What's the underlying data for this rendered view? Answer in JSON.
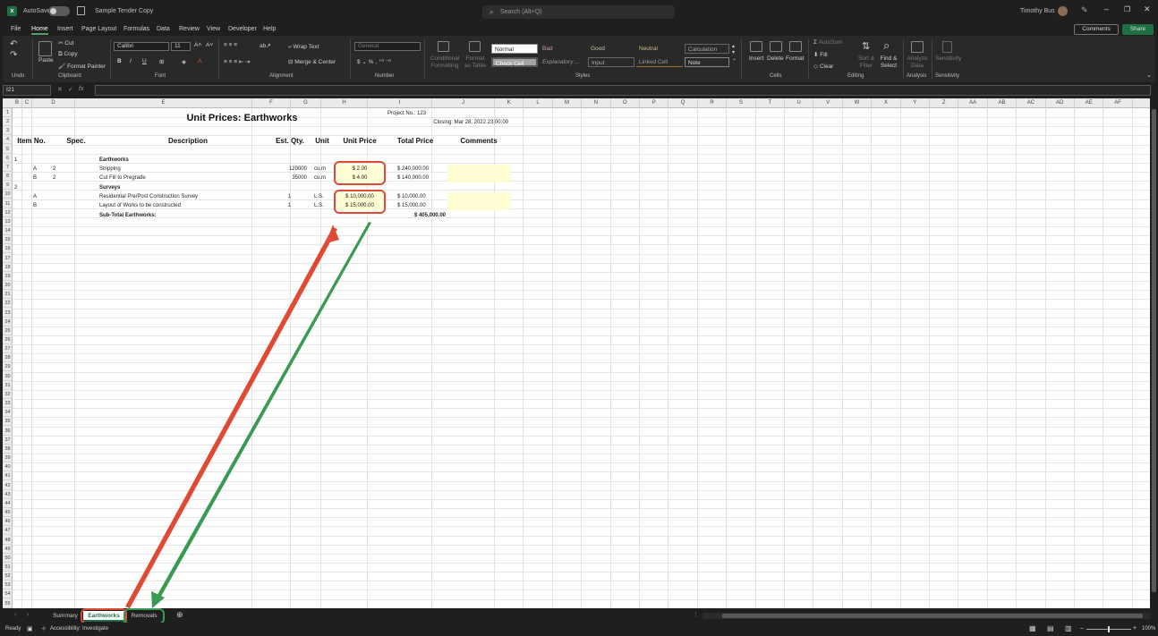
{
  "titlebar": {
    "autosave": "AutoSave",
    "file_name": "Sample Tender Copy",
    "search": "Search (Alt+Q)",
    "user": "Timothy Bus"
  },
  "menu": [
    "File",
    "Home",
    "Insert",
    "Page Layout",
    "Formulas",
    "Data",
    "Review",
    "View",
    "Developer",
    "Help"
  ],
  "top_buttons": {
    "comments": "Comments",
    "share": "Share"
  },
  "ribbon": {
    "undo": "Undo",
    "clipboard": {
      "cut": "Cut",
      "copy": "Copy",
      "paste": "Paste",
      "painter": "Format Painter",
      "label": "Clipboard"
    },
    "font": {
      "name": "Calibri",
      "size": "11",
      "label": "Font"
    },
    "alignment": {
      "wrap": "Wrap Text",
      "merge": "Merge & Center",
      "label": "Alignment"
    },
    "number": {
      "format": "General",
      "label": "Number"
    },
    "styles": {
      "cond": "Conditional Formatting",
      "table": "Format as Table",
      "cells": [
        "Normal",
        "Bad",
        "Good",
        "Neutral",
        "Calculation",
        "Check Cell",
        "Explanatory ...",
        "Input",
        "Linked Cell",
        "Note"
      ],
      "label": "Styles"
    },
    "cells": {
      "insert": "Insert",
      "delete": "Delete",
      "format": "Format",
      "label": "Cells"
    },
    "editing": {
      "autosum": "AutoSum",
      "fill": "Fill",
      "clear": "Clear",
      "sort": "Sort & Filter",
      "find": "Find & Select",
      "label": "Editing"
    },
    "analysis": {
      "analyze": "Analyze Data",
      "label": "Analysis"
    },
    "sensitivity": {
      "btn": "Sensitivity",
      "label": "Sensitivity"
    }
  },
  "formula_bar": {
    "name_box": "I21"
  },
  "columns": [
    "B",
    "C",
    "D",
    "E",
    "F",
    "G",
    "H",
    "I",
    "J",
    "K",
    "L",
    "M",
    "N",
    "O",
    "P",
    "Q",
    "R",
    "S",
    "T",
    "U",
    "V",
    "W",
    "X",
    "Y",
    "Z",
    "AA",
    "AB",
    "AC",
    "AD",
    "AE",
    "AF"
  ],
  "sheet": {
    "title": "Unit Prices: Earthworks",
    "project_no": "Project No.: 123",
    "closing": "Closing: Mar 28, 2022 23:00:00",
    "headers": {
      "item": "Item No.",
      "spec": "Spec.",
      "desc": "Description",
      "qty": "Est. Qty.",
      "unit": "Unit",
      "price": "Unit Price",
      "total": "Total Price",
      "comments": "Comments"
    },
    "rows": [
      {
        "row": 6,
        "b": "1",
        "c": "",
        "d": "",
        "e": "",
        "f": "",
        "g": "",
        "h": "",
        "i": ""
      },
      {
        "row": 6.5,
        "b": "",
        "c": "",
        "d": "",
        "e": "Earthworks",
        "f": "",
        "g": "",
        "h": "",
        "i": ""
      },
      {
        "row": 7,
        "b": "",
        "c": "A",
        "d": "2",
        "e": "Stripping",
        "f": "120000",
        "g": "cu.m",
        "h": "$ 2.00",
        "i": "$ 240,000.00"
      },
      {
        "row": 8,
        "b": "",
        "c": "B",
        "d": "2",
        "e": "Cut Fill to Pregrade",
        "f": "35000",
        "g": "cu.m",
        "h": "$ 4.00",
        "i": "$ 140,000.00"
      },
      {
        "row": 9,
        "b": "2",
        "c": "",
        "d": "",
        "e": "Surveys",
        "f": "",
        "g": "",
        "h": "",
        "i": ""
      },
      {
        "row": 10,
        "b": "",
        "c": "A",
        "d": "",
        "e": "Residential Pre/Post Construction Survey",
        "f": "1",
        "g": "L.S.",
        "h": "$ 10,000.00",
        "i": "$ 10,000.00"
      },
      {
        "row": 11,
        "b": "",
        "c": "B",
        "d": "",
        "e": "Layout of Works to be constructed",
        "f": "1",
        "g": "L.S.",
        "h": "$ 15,000.00",
        "i": "$ 15,000.00"
      },
      {
        "row": 12,
        "b": "",
        "c": "",
        "d": "",
        "e": "Sub-Total Earthworks:",
        "f": "",
        "g": "",
        "h": "",
        "i": "$ 405,000.00"
      }
    ]
  },
  "tabs": [
    "Summary",
    "Earthworks",
    "Removals"
  ],
  "status": {
    "ready": "Ready",
    "accessibility": "Accessibility: Investigate",
    "zoom": "100%"
  },
  "annotation_colors": {
    "red": "#e04a33",
    "green": "#3a9a54"
  }
}
